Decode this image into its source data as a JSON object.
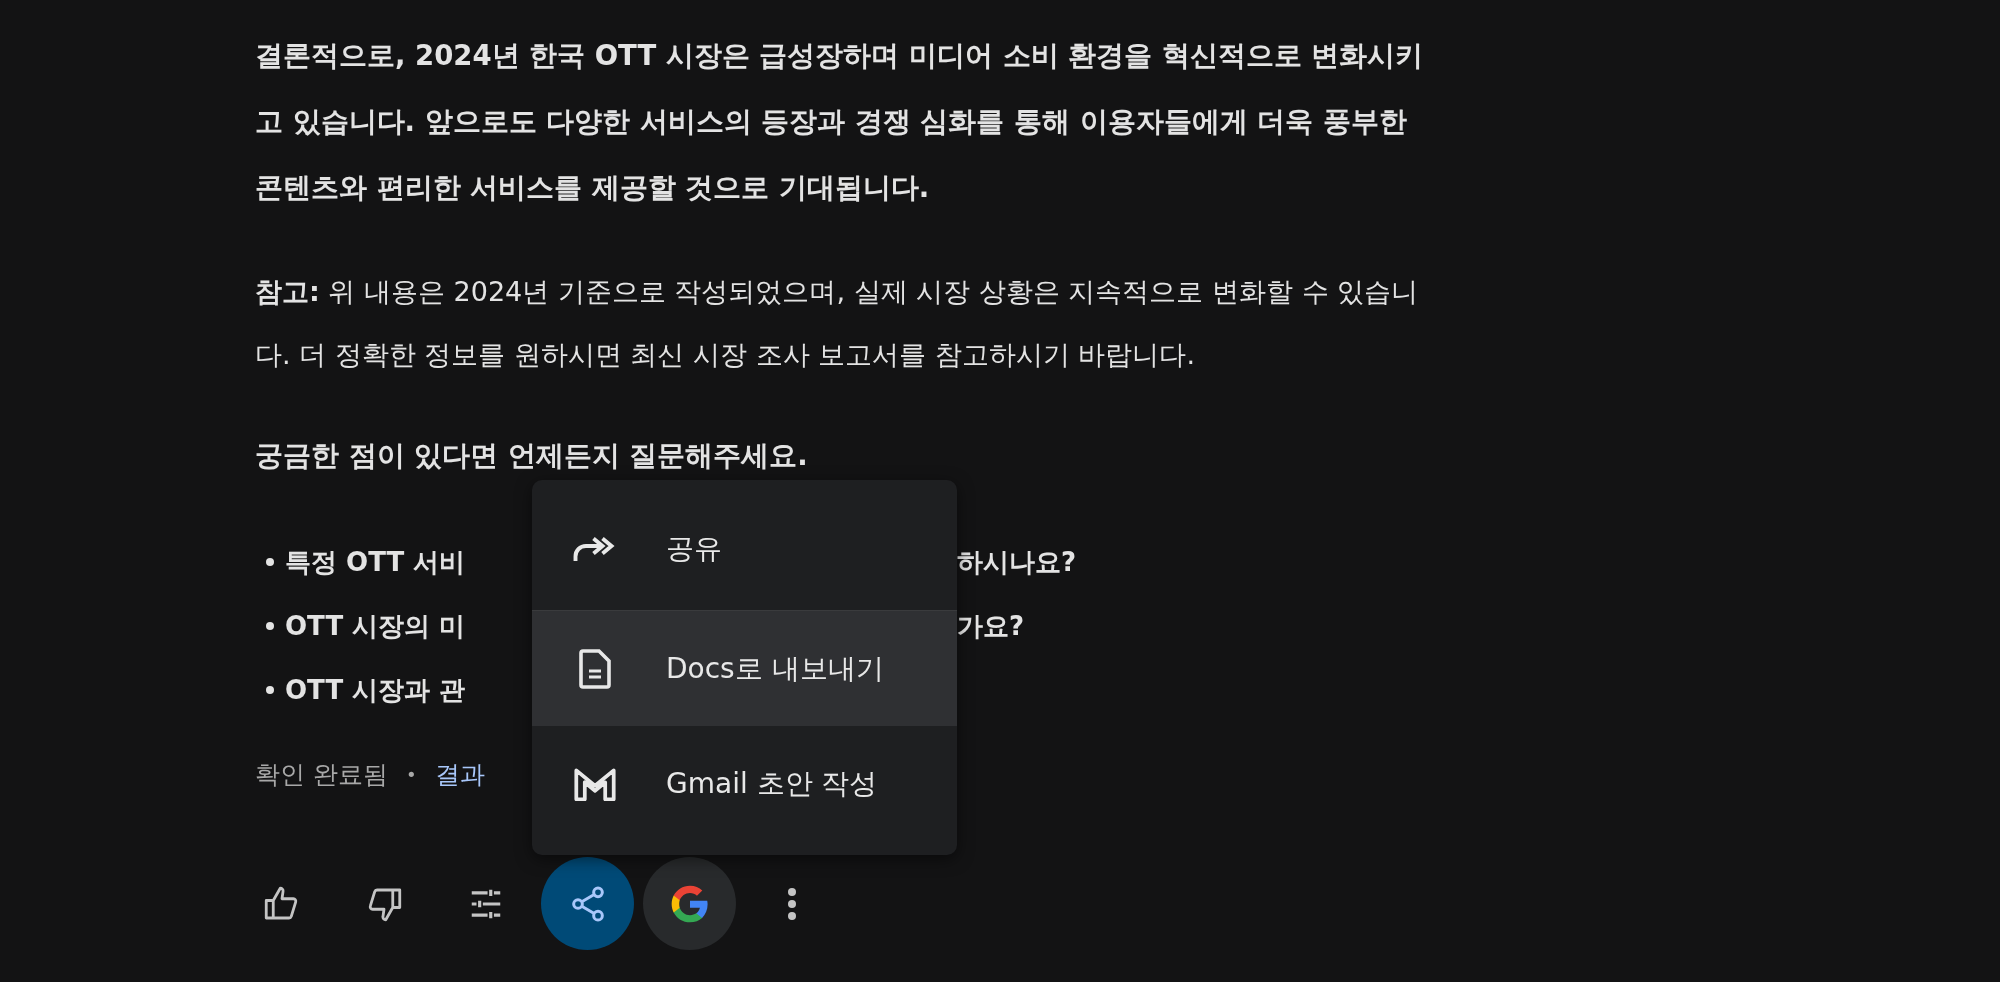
{
  "conclusion": "결론적으로, 2024년 한국 OTT 시장은 급성장하며 미디어 소비 환경을 혁신적으로 변화시키고 있습니다. 앞으로도 다양한 서비스의 등장과 경쟁 심화를 통해 이용자들에게 더욱 풍부한 콘텐츠와 편리한 서비스를 제공할 것으로 기대됩니다.",
  "note": "**참고:** 위 내용은 2024년 기준으로 작성되었으며, 실제 시장 상황은 지속적으로 변화할 수 있습니다. 더 정확한 정보를 원하시면 최신 시장 조사 보고서를 참고하시기 바랍니다.",
  "question": "궁금한 점이 있다면 언제든지 질문해주세요.",
  "bullets": [
    {
      "start": "특정 OTT 서비",
      "end": "하시나요?"
    },
    {
      "start": "OTT 시장의 미",
      "end": "가요?"
    },
    {
      "start": "OTT 시장과 관"
    }
  ],
  "status": {
    "label": "확인 완료됨",
    "separator": "•",
    "link": "결과"
  },
  "share_menu": {
    "items": [
      {
        "kind": "share",
        "label": "공유",
        "selected": false
      },
      {
        "kind": "docs",
        "label": "Docs로 내보내기",
        "selected": true
      },
      {
        "kind": "gmail",
        "label": "Gmail 초안 작성",
        "selected": false
      }
    ]
  },
  "toolbar": [
    {
      "kind": "like",
      "selected": false
    },
    {
      "kind": "dislike",
      "selected": false
    },
    {
      "kind": "tune",
      "selected": false
    },
    {
      "kind": "share",
      "selected": true
    },
    {
      "kind": "google",
      "selected": false
    },
    {
      "kind": "more",
      "selected": false
    }
  ]
}
